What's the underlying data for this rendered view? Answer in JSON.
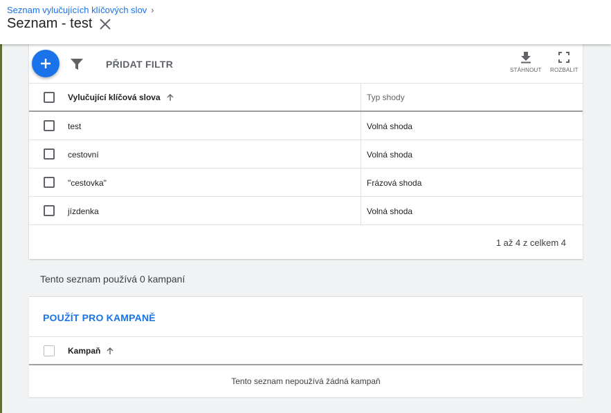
{
  "header": {
    "breadcrumb": "Seznam vylučujících klíčových slov",
    "breadcrumb_chevron": "›",
    "title": "Seznam - test"
  },
  "toolbar": {
    "add_filter": "PŘIDAT FILTR",
    "download": "STÁHNOUT",
    "expand": "ROZBALIT"
  },
  "keywords_table": {
    "columns": [
      "Vylučující klíčová slova",
      "Typ shody"
    ],
    "rows": [
      {
        "keyword": "test",
        "match": "Volná shoda"
      },
      {
        "keyword": "cestovní",
        "match": "Volná shoda"
      },
      {
        "keyword": "\"cestovka\"",
        "match": "Frázová shoda"
      },
      {
        "keyword": "jízdenka",
        "match": "Volná shoda"
      }
    ],
    "pagination": "1 až 4 z celkem 4"
  },
  "campaigns": {
    "usage_text": "Tento seznam používá 0 kampaní",
    "apply_label": "POUŽÍT PRO KAMPANĚ",
    "column": "Kampaň",
    "empty_message": "Tento seznam nepoužívá žádná kampaň"
  },
  "colors": {
    "accent": "#1a73e8",
    "background": "#f1f3f4"
  }
}
